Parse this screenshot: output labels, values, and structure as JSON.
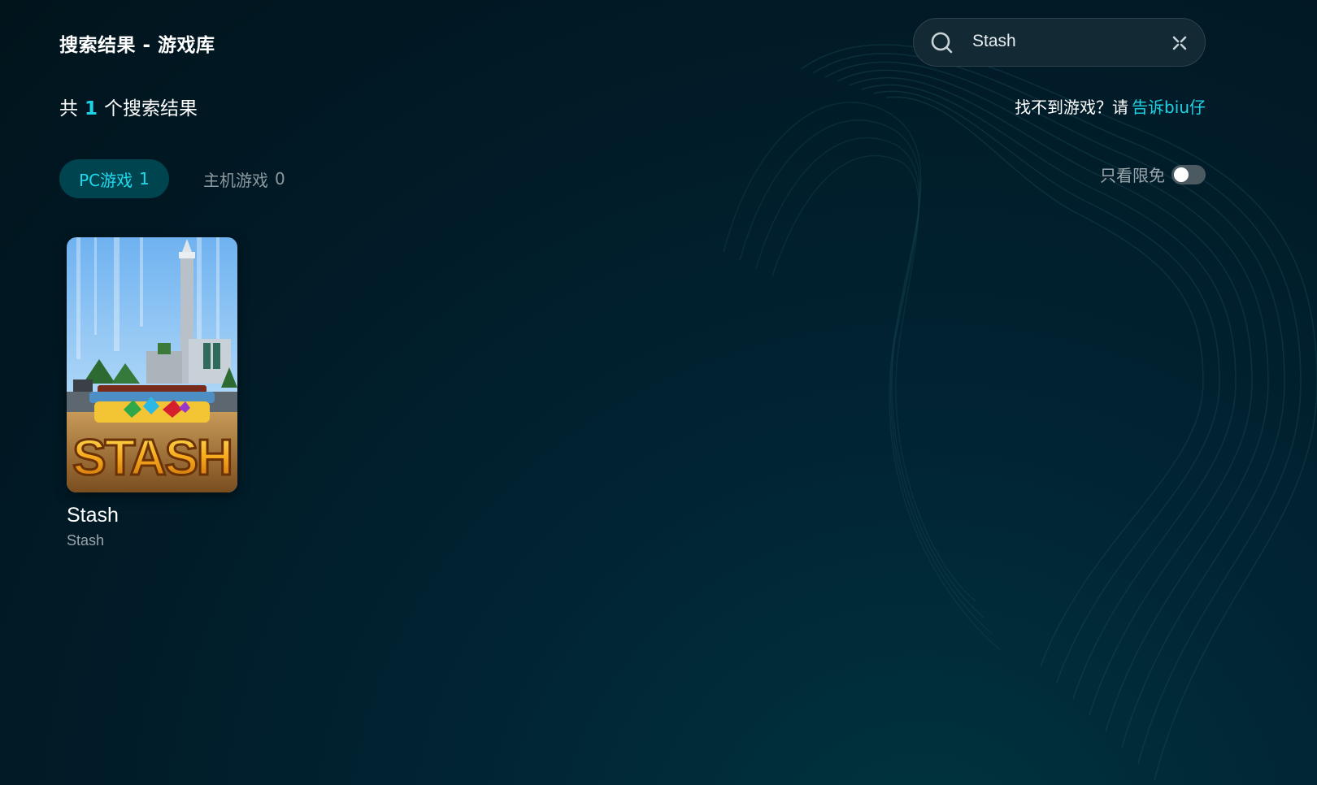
{
  "header": {
    "title": "搜索结果 - 游戏库"
  },
  "search": {
    "query": "Stash"
  },
  "results": {
    "prefix": "共",
    "count": "1",
    "suffix": "个搜索结果"
  },
  "feedback": {
    "text": "找不到游戏？请",
    "link": "告诉biu仔"
  },
  "tabs": [
    {
      "label": "PC游戏",
      "count": "1",
      "active": true
    },
    {
      "label": "主机游戏",
      "count": "0",
      "active": false
    }
  ],
  "filter": {
    "free_only_label": "只看限免",
    "free_only_on": false
  },
  "games": [
    {
      "title": "Stash",
      "subtitle": "Stash",
      "logo_text": "STASH"
    }
  ],
  "colors": {
    "accent": "#1fd3e6",
    "background": "#012433",
    "tab_active_bg": "#00444f"
  },
  "icons": {
    "search": "search-icon",
    "clear": "close-icon"
  }
}
